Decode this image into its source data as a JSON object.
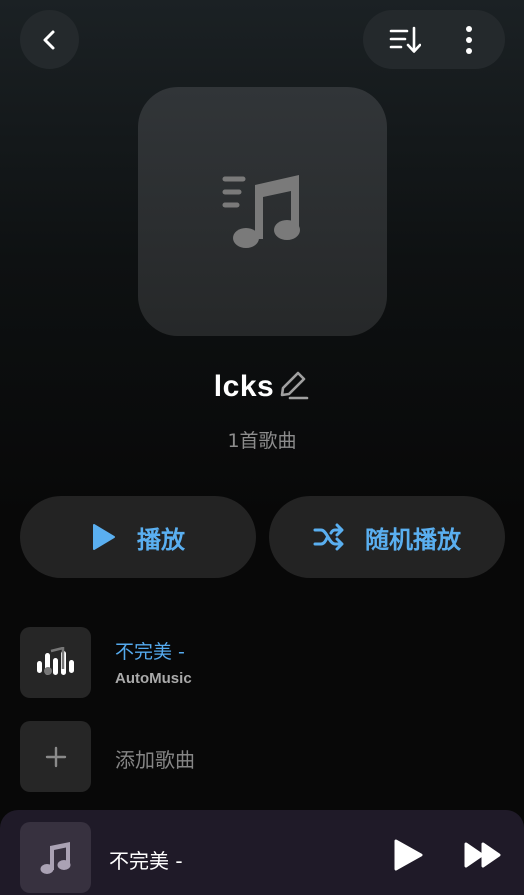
{
  "header": {
    "back_icon": "chevron-left-icon",
    "sort_icon": "sort-icon",
    "more_icon": "more-vertical-icon"
  },
  "playlist": {
    "cover_icon": "music-playlist-icon",
    "name": "lcks",
    "edit_icon": "pencil-icon",
    "count_text": "1首歌曲"
  },
  "actions": {
    "play_label": "播放",
    "shuffle_label": "随机播放"
  },
  "songs": [
    {
      "title": "不完美 -",
      "artist": "AutoMusic",
      "icon": "equalizer-icon"
    }
  ],
  "add_song": {
    "label": "添加歌曲",
    "icon": "plus-icon"
  },
  "now_playing": {
    "title": "不完美 -",
    "thumb_icon": "music-note-icon",
    "play_icon": "play-icon",
    "next_icon": "fast-forward-icon"
  },
  "colors": {
    "accent": "#5aaff0",
    "background": "#080808",
    "player_bg": "#1f1a28"
  }
}
